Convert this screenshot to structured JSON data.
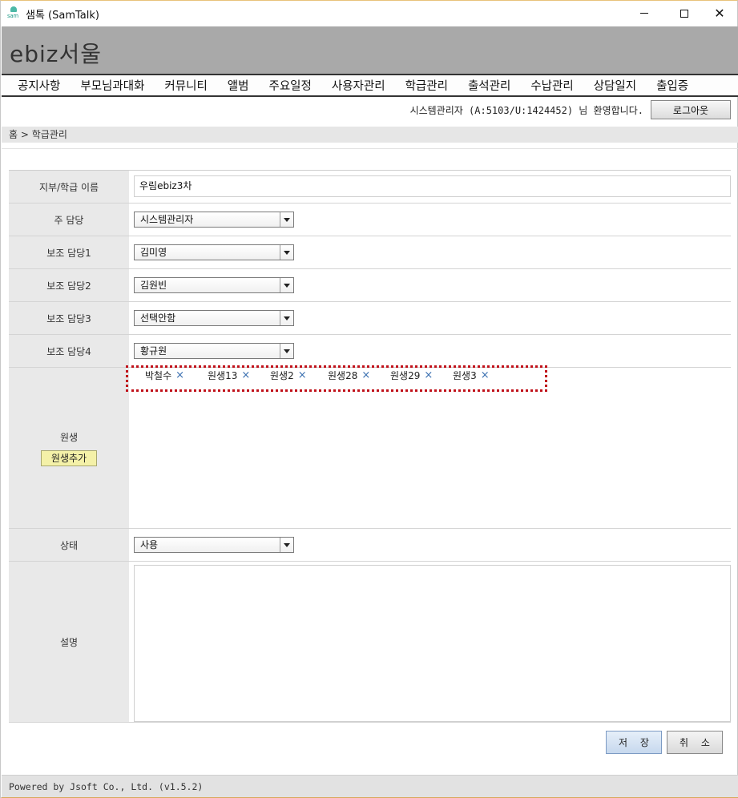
{
  "window": {
    "title": "샘톡 (SamTalk)",
    "icon_label": "sam",
    "minimize_icon": "minimize-icon",
    "maximize_icon": "maximize-icon",
    "close_glyph": "✕"
  },
  "brand": {
    "name": "ebiz서울"
  },
  "nav": {
    "items": [
      {
        "label": "공지사항"
      },
      {
        "label": "부모님과대화"
      },
      {
        "label": "커뮤니티"
      },
      {
        "label": "앨범"
      },
      {
        "label": "주요일정"
      },
      {
        "label": "사용자관리"
      },
      {
        "label": "학급관리"
      },
      {
        "label": "출석관리"
      },
      {
        "label": "수납관리"
      },
      {
        "label": "상담일지"
      },
      {
        "label": "출입증"
      }
    ]
  },
  "user": {
    "welcome": "시스템관리자 (A:5103/U:1424452) 님 환영합니다.",
    "logout_label": "로그아웃"
  },
  "breadcrumb": {
    "text": "홈 > 학급관리"
  },
  "form": {
    "class_name": {
      "label": "지부/학급 이름",
      "value": "우림ebiz3차"
    },
    "main_teacher": {
      "label": "주 담당",
      "value": "시스템관리자"
    },
    "assistant1": {
      "label": "보조 담당1",
      "value": "김미영"
    },
    "assistant2": {
      "label": "보조 담당2",
      "value": "김원빈"
    },
    "assistant3": {
      "label": "보조 담당3",
      "value": "선택안함"
    },
    "assistant4": {
      "label": "보조 담당4",
      "value": "황규원"
    },
    "students": {
      "label": "원생",
      "add_label": "원생추가",
      "remove_glyph": "×",
      "list": [
        {
          "name": "박철수"
        },
        {
          "name": "원생13"
        },
        {
          "name": "원생2"
        },
        {
          "name": "원생28"
        },
        {
          "name": "원생29"
        },
        {
          "name": "원생3"
        }
      ]
    },
    "status": {
      "label": "상태",
      "value": "사용"
    },
    "description": {
      "label": "설명",
      "value": ""
    }
  },
  "actions": {
    "save_label": "저 장",
    "cancel_label": "취 소"
  },
  "footer": {
    "text": "Powered by Jsoft Co., Ltd. (v1.5.2)"
  },
  "colors": {
    "highlight_box": "#c0111a",
    "brand_bar": "#a9a9a9",
    "add_button": "#f4f1a8"
  }
}
